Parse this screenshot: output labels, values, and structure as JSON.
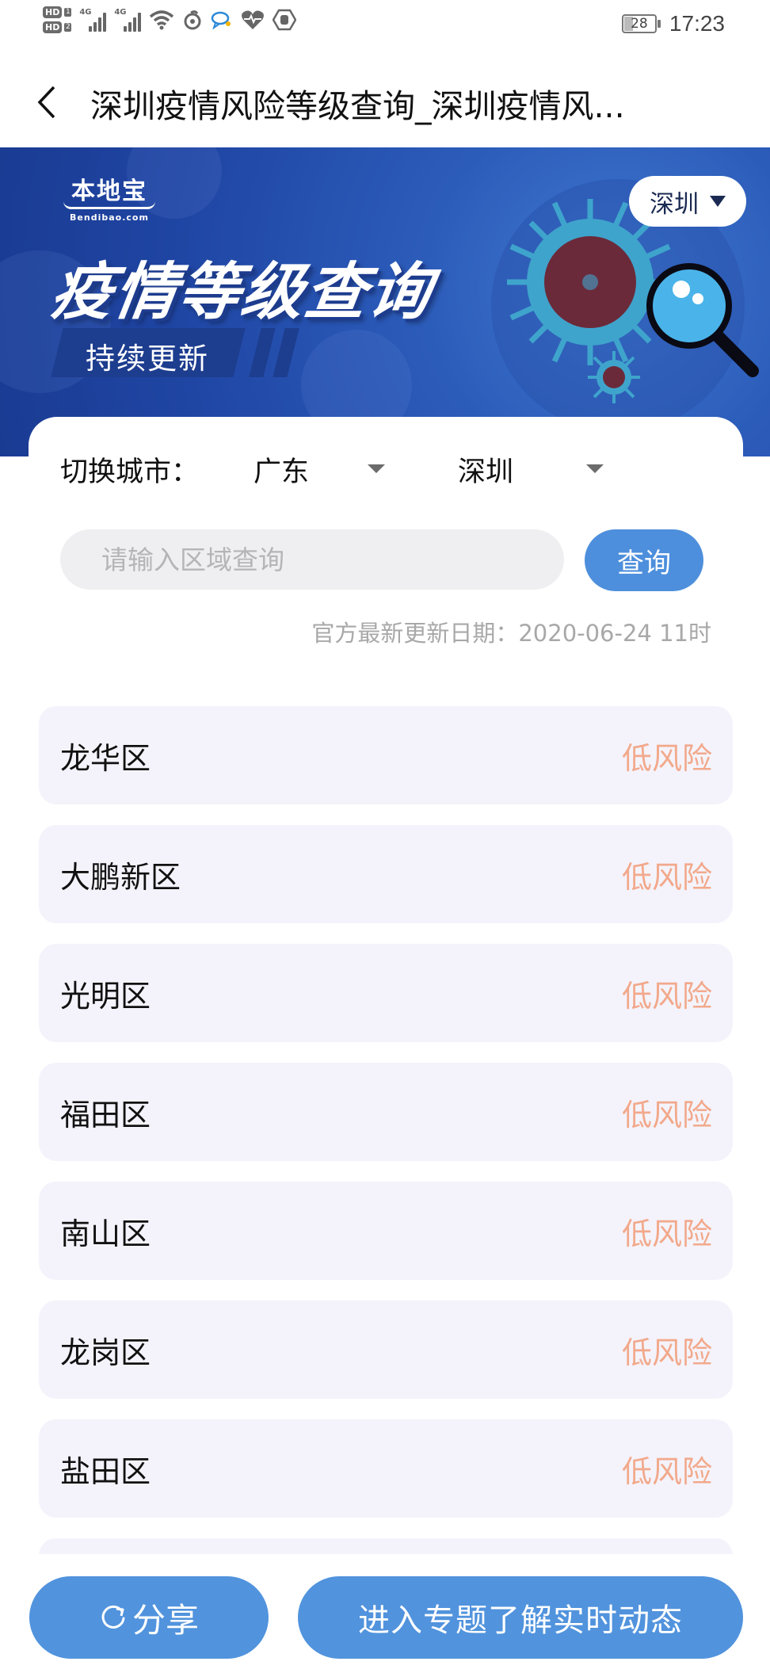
{
  "status_bar": {
    "sim1_label": "HD",
    "sim1_num": "1",
    "sim2_label": "HD",
    "sim2_num": "2",
    "network1": "4G",
    "network2": "4G",
    "icons": [
      "wifi-icon",
      "netease-music-icon",
      "chat-icon",
      "health-heart-icon",
      "hand-stop-icon"
    ],
    "battery": "28",
    "battery_level_percent": 28,
    "time": "17:23"
  },
  "navbar": {
    "title": "深圳疫情风险等级查询_深圳疫情风..."
  },
  "banner": {
    "logo_cn": "本地宝",
    "logo_en": "Bendibao.com",
    "title": "疫情等级查询",
    "ribbon_text": "持续更新",
    "city_pill": "深圳"
  },
  "filters": {
    "label": "切换城市：",
    "province": "广东",
    "city": "深圳"
  },
  "search": {
    "placeholder": "请输入区域查询",
    "value": "",
    "button_label": "查询"
  },
  "update_text": "官方最新更新日期：2020-06-24 11时",
  "districts": [
    {
      "name": "龙华区",
      "risk": "低风险"
    },
    {
      "name": "大鹏新区",
      "risk": "低风险"
    },
    {
      "name": "光明区",
      "risk": "低风险"
    },
    {
      "name": "福田区",
      "risk": "低风险"
    },
    {
      "name": "南山区",
      "risk": "低风险"
    },
    {
      "name": "龙岗区",
      "risk": "低风险"
    },
    {
      "name": "盐田区",
      "risk": "低风险"
    },
    {
      "name": "",
      "risk": ""
    }
  ],
  "bottom": {
    "share_label": "分享",
    "topic_label": "进入专题了解实时动态"
  },
  "colors": {
    "primary_blue": "#5193dd",
    "risk_low": "#f2a98c",
    "row_bg": "#f4f3fb",
    "banner_blue": "#2c5cba"
  }
}
